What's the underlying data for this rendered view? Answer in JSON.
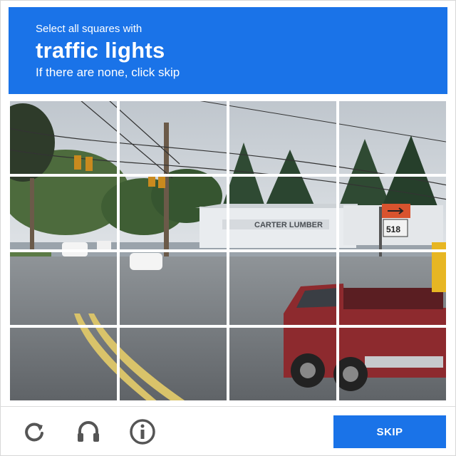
{
  "header": {
    "instruction": "Select all squares with",
    "target": "traffic lights",
    "hint": "If there are none, click skip"
  },
  "scene_text": {
    "store_sign": "CARTER LUMBER",
    "route_number": "518"
  },
  "grid": {
    "rows": 4,
    "cols": 4
  },
  "footer": {
    "reload_icon": "reload-icon",
    "audio_icon": "headphones-icon",
    "info_icon": "info-icon",
    "skip_label": "SKIP"
  },
  "colors": {
    "accent": "#1a73e8"
  }
}
